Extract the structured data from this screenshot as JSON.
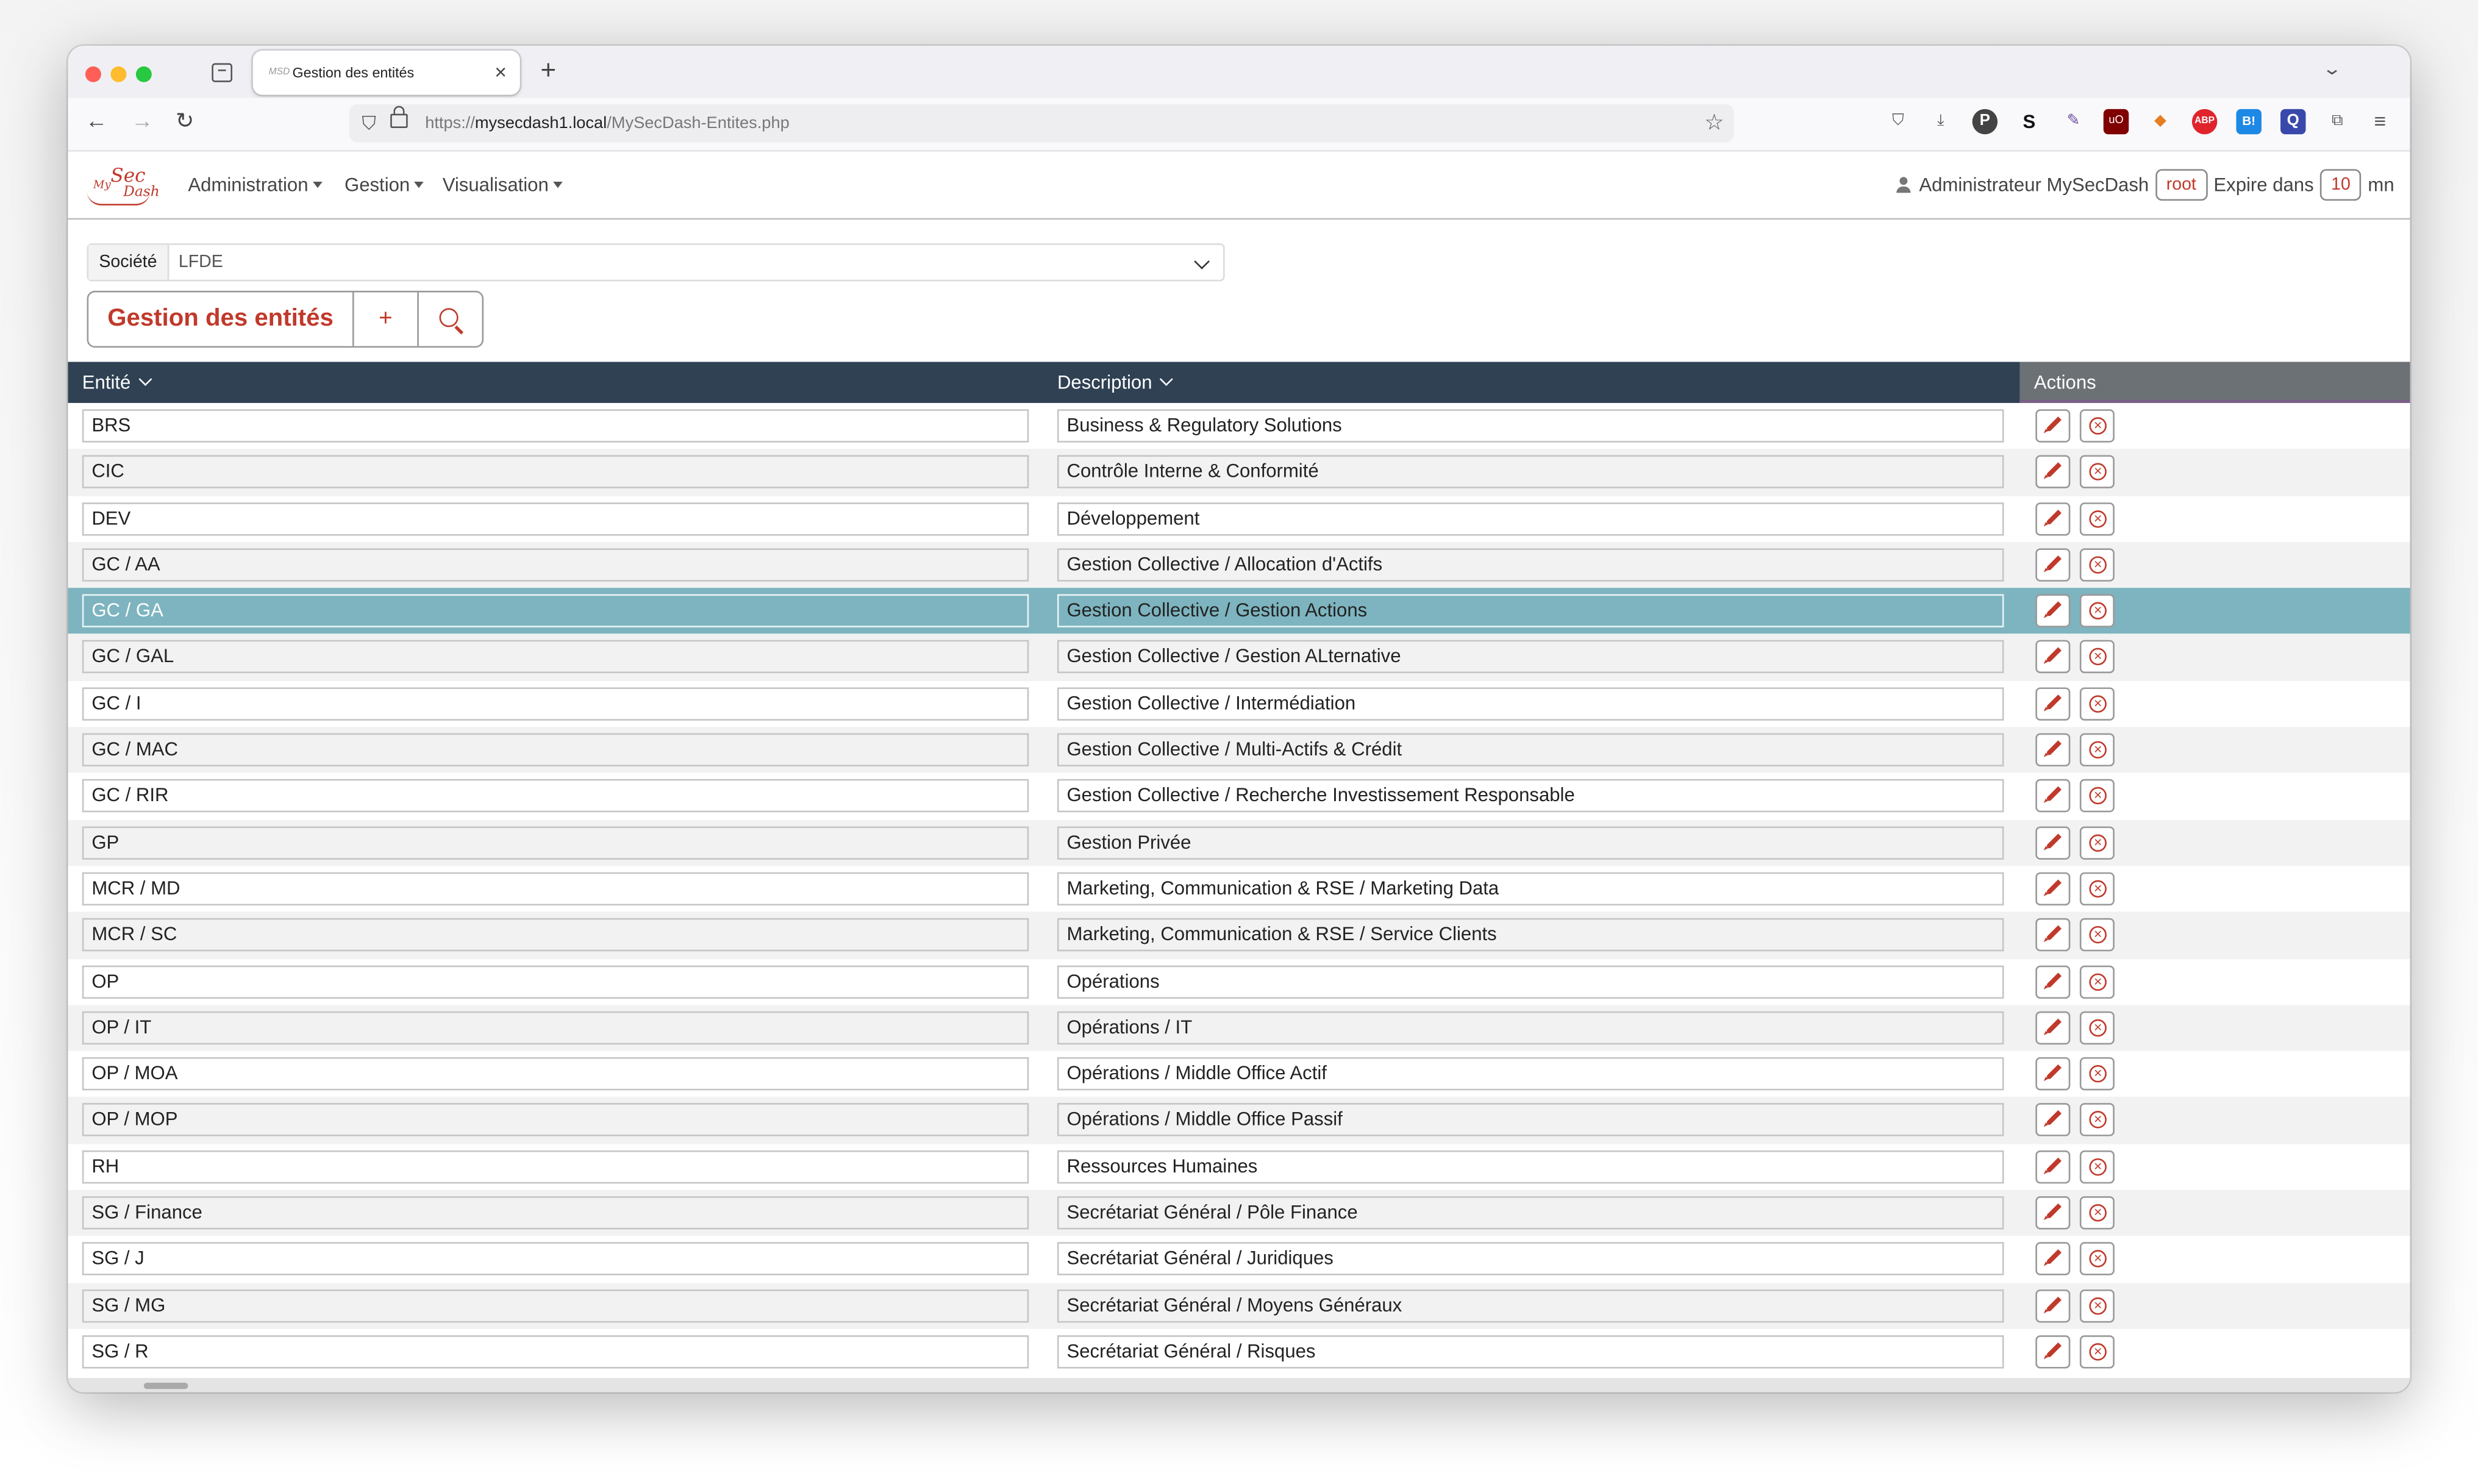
{
  "browser": {
    "tab_title": "Gestion des entités",
    "tab_favicon": "MSD",
    "url_prefix": "https://",
    "url_host": "mysecdash1.local",
    "url_path": "/MySecDash-Entites.php",
    "extensions": [
      "pocket-icon",
      "download-icon",
      "P",
      "S",
      "pen-icon",
      "ublock-icon",
      "fox-icon",
      "ABP",
      "B!",
      "Q",
      "puzzle-icon"
    ]
  },
  "app": {
    "logo": {
      "my": "My",
      "sec": "Sec",
      "dash": "Dash"
    },
    "menus": [
      "Administration",
      "Gestion",
      "Visualisation"
    ],
    "user_name": "Administrateur MySecDash",
    "user_login": "root",
    "expire_label": "Expire dans",
    "expire_value": "10",
    "expire_unit": "mn",
    "accent": "#c0392b"
  },
  "societe": {
    "label": "Société",
    "value": "LFDE"
  },
  "page": {
    "title": "Gestion des entités",
    "add_label": "+"
  },
  "table": {
    "headers": {
      "entity": "Entité",
      "description": "Description",
      "actions": "Actions"
    },
    "selected_index": 4,
    "rows": [
      {
        "entity": "BRS",
        "description": "Business & Regulatory Solutions"
      },
      {
        "entity": "CIC",
        "description": "Contrôle Interne & Conformité"
      },
      {
        "entity": "DEV",
        "description": "Développement"
      },
      {
        "entity": "GC / AA",
        "description": "Gestion Collective / Allocation d'Actifs"
      },
      {
        "entity": "GC / GA",
        "description": "Gestion Collective / Gestion Actions"
      },
      {
        "entity": "GC / GAL",
        "description": "Gestion Collective / Gestion ALternative"
      },
      {
        "entity": "GC / I",
        "description": "Gestion Collective / Intermédiation"
      },
      {
        "entity": "GC / MAC",
        "description": "Gestion Collective / Multi-Actifs & Crédit"
      },
      {
        "entity": "GC / RIR",
        "description": "Gestion Collective / Recherche Investissement Responsable"
      },
      {
        "entity": "GP",
        "description": "Gestion Privée"
      },
      {
        "entity": "MCR / MD",
        "description": "Marketing, Communication & RSE / Marketing Data"
      },
      {
        "entity": "MCR / SC",
        "description": "Marketing, Communication & RSE / Service Clients"
      },
      {
        "entity": "OP",
        "description": "Opérations"
      },
      {
        "entity": "OP / IT",
        "description": "Opérations / IT"
      },
      {
        "entity": "OP / MOA",
        "description": "Opérations / Middle Office Actif"
      },
      {
        "entity": "OP / MOP",
        "description": "Opérations / Middle Office Passif"
      },
      {
        "entity": "RH",
        "description": "Ressources Humaines"
      },
      {
        "entity": "SG / Finance",
        "description": "Secrétariat Général / Pôle Finance"
      },
      {
        "entity": "SG / J",
        "description": "Secrétariat Général / Juridiques"
      },
      {
        "entity": "SG / MG",
        "description": "Secrétariat Général / Moyens Généraux"
      },
      {
        "entity": "SG / R",
        "description": "Secrétariat Général / Risques"
      }
    ]
  }
}
